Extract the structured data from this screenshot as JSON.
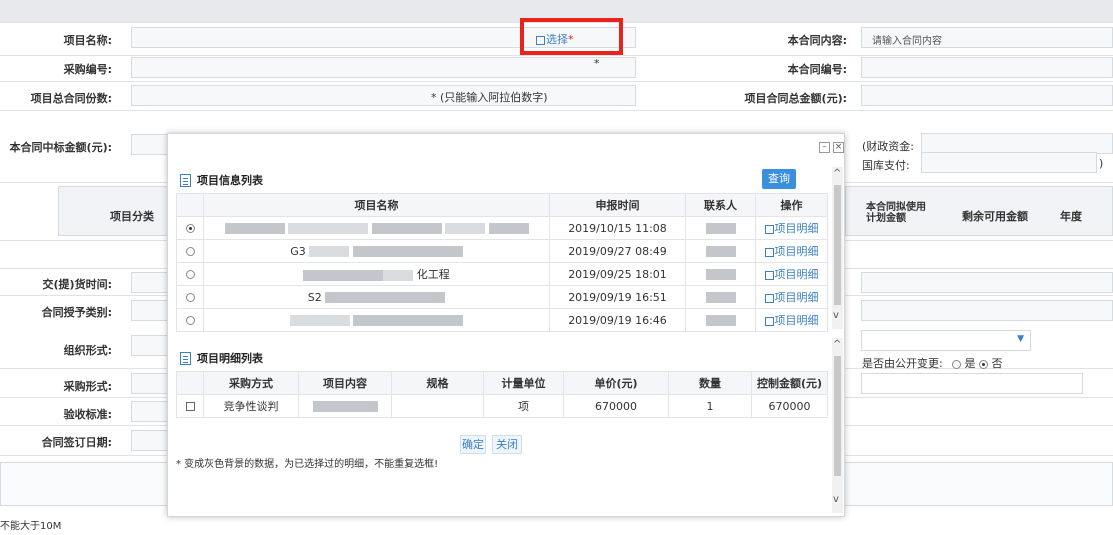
{
  "form": {
    "project_name_label": "项目名称:",
    "select_link": "选择",
    "required_mark": "*",
    "contract_content_label": "本合同内容:",
    "contract_content_placeholder": "请输入合同内容",
    "purchase_no_label": "采购编号:",
    "contract_no_label": "本合同编号:",
    "total_contracts_label": "项目总合同份数:",
    "digits_only_hint": "* (只能输入阿拉伯数字)",
    "total_amount_label": "项目合同总金额(元):",
    "bid_amount_label": "本合同中标金额(元):",
    "fiscal_funds_label": "(财政资金:",
    "treasury_label": "国库支付:",
    "close_paren": ")",
    "project_category_label": "项目分类",
    "planned_amount_label": "本合同拟使用计划金额",
    "remaining_amount_label": "剩余可用金额",
    "year_label": "年度",
    "delivery_time_label": "交(提)货时间:",
    "grant_type_label": "合同授予类别:",
    "org_form_label": "组织形式:",
    "public_change_label": "是否由公开变更:",
    "yes_label": "是",
    "no_label": "否",
    "purchase_form_label": "采购形式:",
    "acceptance_label": "验收标准:",
    "sign_date_label": "合同签订日期:",
    "size_limit": "不能大于10M"
  },
  "modal": {
    "info_list_title": "项目信息列表",
    "query_button": "查询",
    "info_headers": [
      "",
      "项目名称",
      "申报时间",
      "联系人",
      "操作"
    ],
    "info_rows": [
      {
        "selected": true,
        "name_fragment": "",
        "time": "2019/10/15 11:08",
        "action": "项目明细"
      },
      {
        "selected": false,
        "name_fragment": "G3",
        "time": "2019/09/27 08:49",
        "action": "项目明细"
      },
      {
        "selected": false,
        "name_fragment": "化工程",
        "time": "2019/09/25 18:01",
        "action": "项目明细"
      },
      {
        "selected": false,
        "name_fragment": "S2",
        "time": "2019/09/19 16:51",
        "action": "项目明细"
      },
      {
        "selected": false,
        "name_fragment": "",
        "time": "2019/09/19 16:46",
        "action": "项目明细"
      }
    ],
    "detail_list_title": "项目明细列表",
    "detail_headers": [
      "",
      "采购方式",
      "项目内容",
      "规格",
      "计量单位",
      "单价(元)",
      "数量",
      "控制金额(元)"
    ],
    "detail_rows": [
      {
        "method": "竞争性谈判",
        "spec": "",
        "unit": "项",
        "price": "670000",
        "qty": "1",
        "amount": "670000"
      }
    ],
    "confirm_button": "确定",
    "close_button": "关闭",
    "note": "* 变成灰色背景的数据，为已选择过的明细，不能重复选框!"
  },
  "colors": {
    "highlight": "#e8231b",
    "link": "#3b7fc4",
    "primary": "#3b8fdc",
    "warning": "#d9221b"
  }
}
